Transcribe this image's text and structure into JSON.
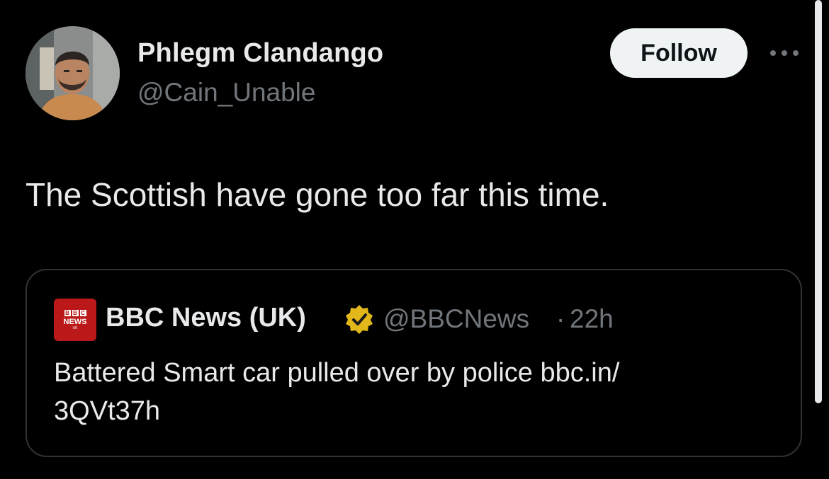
{
  "author": {
    "display_name": "Phlegm Clandango",
    "handle": "@Cain_Unable",
    "avatar_icon": "profile-photo"
  },
  "actions": {
    "follow_label": "Follow",
    "more_icon": "more-horizontal-icon"
  },
  "tweet": {
    "text": "The Scottish have gone too far this time."
  },
  "quote": {
    "logo": {
      "letters": [
        "B",
        "B",
        "C"
      ],
      "news": "NEWS",
      "region": "UK"
    },
    "display_name": "BBC News (UK)",
    "verified_icon": "verified-gold-badge-icon",
    "handle": "@BBCNews",
    "separator": "·",
    "time": "22h",
    "text_lines": [
      "Battered Smart car pulled over by police bbc.in/",
      "3QVt37h"
    ]
  },
  "colors": {
    "background": "#000000",
    "primary_text": "#e7e9ea",
    "secondary_text": "#71767b",
    "follow_bg": "#eff3f4",
    "border": "#2f3336",
    "bbc_red": "#bb1919",
    "verified_gold": "#e2b719"
  }
}
